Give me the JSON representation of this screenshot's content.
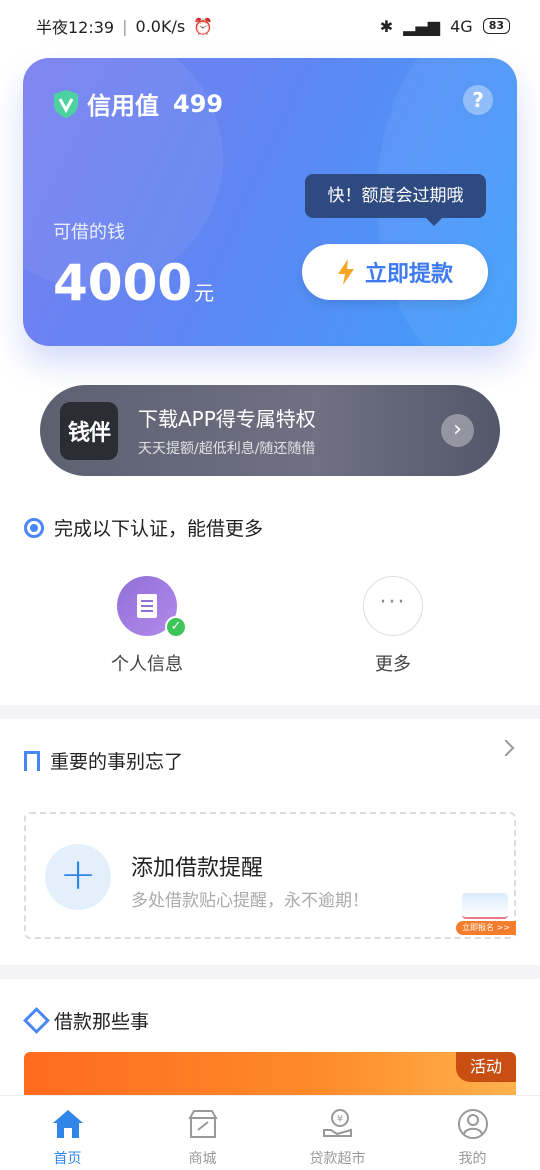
{
  "status_bar": {
    "time": "半夜12:39",
    "network_speed": "0.0K/s",
    "signal": "4G",
    "battery": "83"
  },
  "credit_card": {
    "title": "信用值",
    "score": "499",
    "available_label": "可借的钱",
    "amount": "4000",
    "unit": "元",
    "tooltip": "快！额度会过期哦",
    "withdraw_label": "立即提款"
  },
  "app_banner": {
    "logo_text": "钱伴",
    "title": "下载APP得专属特权",
    "subtitle": "天天提额/超低利息/随还随借"
  },
  "verification": {
    "heading": "完成以下认证，能借更多",
    "items": [
      {
        "label": "个人信息",
        "status": "verified"
      },
      {
        "label": "更多"
      }
    ]
  },
  "reminder": {
    "heading": "重要的事别忘了",
    "add_title": "添加借款提醒",
    "add_subtitle": "多处借款贴心提醒，永不逾期！",
    "promo_tag": "立即报名 >>"
  },
  "loans": {
    "heading": "借款那些事",
    "activity_tag": "活动"
  },
  "tabs": [
    {
      "label": "首页",
      "icon": "home-icon",
      "active": true
    },
    {
      "label": "商城",
      "icon": "store-icon",
      "active": false
    },
    {
      "label": "贷款超市",
      "icon": "loan-market-icon",
      "active": false
    },
    {
      "label": "我的",
      "icon": "profile-icon",
      "active": false
    }
  ],
  "colors": {
    "accent": "#2f86e8",
    "card_start": "#7a7ff0",
    "card_end": "#3ea0fb",
    "promo_orange": "#ff6a1f"
  }
}
